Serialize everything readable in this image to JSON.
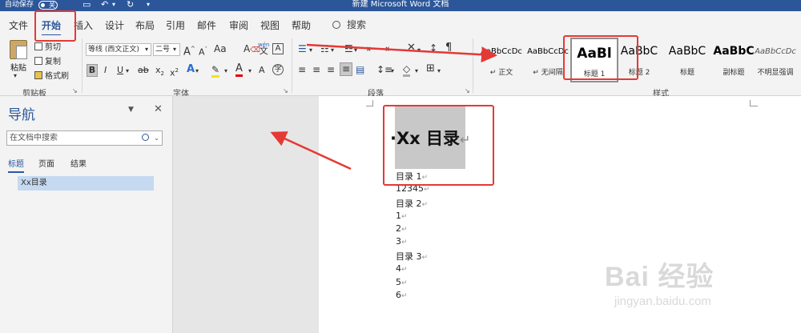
{
  "titlebar": {
    "autosave_label": "自动保存",
    "autosave_state": "关",
    "doc_title": "新建 Microsoft Word 文档"
  },
  "tabs": [
    "文件",
    "开始",
    "插入",
    "设计",
    "布局",
    "引用",
    "邮件",
    "审阅",
    "视图",
    "帮助"
  ],
  "active_tab": "开始",
  "search_tab": "搜索",
  "clipboard": {
    "paste": "粘贴",
    "cut": "剪切",
    "copy": "复制",
    "format_painter": "格式刷",
    "group_label": "剪贴板"
  },
  "font": {
    "font_name": "等线 (西文正文)",
    "font_size": "二号",
    "group_label": "字体"
  },
  "paragraph": {
    "group_label": "段落"
  },
  "styles": {
    "group_label": "样式",
    "items": [
      {
        "sample": "AaBbCcDc",
        "name": "正文"
      },
      {
        "sample": "AaBbCcDc",
        "name": "无间隔"
      },
      {
        "sample": "AaBl",
        "name": "标题 1"
      },
      {
        "sample": "AaBbC",
        "name": "标题 2"
      },
      {
        "sample": "AaBbC",
        "name": "标题"
      },
      {
        "sample": "AaBbC",
        "name": "副标题"
      },
      {
        "sample": "AaBbCcDc",
        "name": "不明显强调"
      }
    ],
    "selected_index": 2
  },
  "nav": {
    "title": "导航",
    "search_placeholder": "在文档中搜索",
    "tabs": [
      "标题",
      "页面",
      "结果"
    ],
    "active_tab": "标题",
    "items": [
      "Xx目录"
    ]
  },
  "document": {
    "heading": "Xx 目录",
    "lines": [
      "目录 1",
      "12345",
      "目录 2",
      "1",
      "2",
      "3",
      "目录 3",
      "4",
      "5",
      "6"
    ]
  },
  "watermark": {
    "brand": "Bai 经验",
    "url": "jingyan.baidu.com"
  },
  "colors": {
    "accent": "#2b579a",
    "annotation": "#e53935"
  }
}
